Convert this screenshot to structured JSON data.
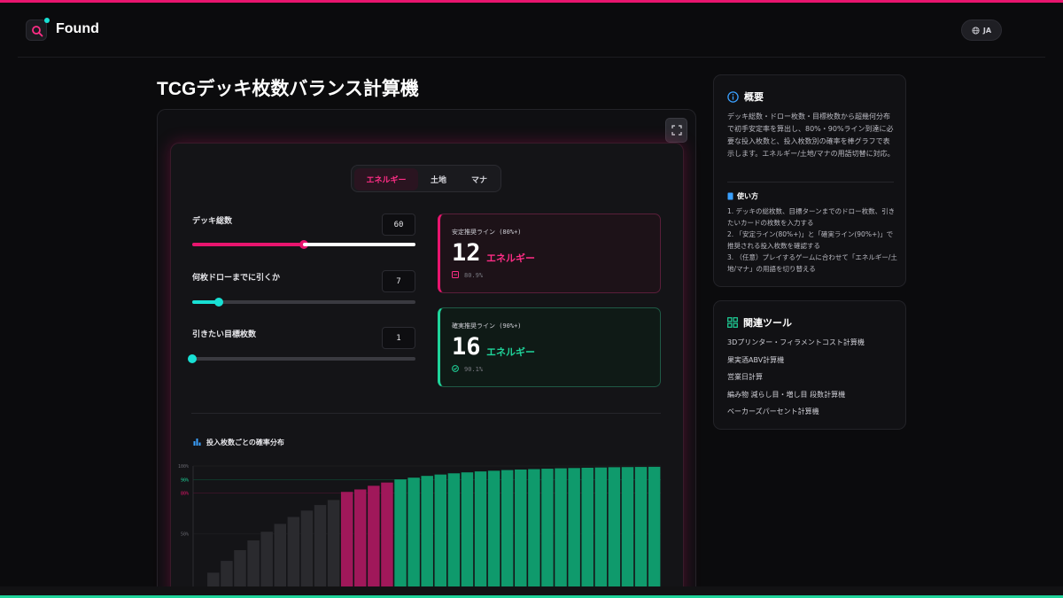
{
  "brand": "Found",
  "lang": "JA",
  "page_title": "TCGデッキ枚数バランス計算機",
  "tabs": [
    {
      "label": "エネルギー",
      "active": true
    },
    {
      "label": "土地",
      "active": false
    },
    {
      "label": "マナ",
      "active": false
    }
  ],
  "inputs": {
    "deck": {
      "label": "デッキ総数",
      "value": "60",
      "slider_fraction": 0.5
    },
    "draws": {
      "label": "何枚ドローまでに引くか",
      "value": "7",
      "slider_fraction": 0.12
    },
    "target": {
      "label": "引きたい目標枚数",
      "value": "1",
      "slider_fraction": 0.0
    }
  },
  "results": {
    "stable": {
      "title": "安定推奨ライン (80%+)",
      "count": "12",
      "unit": "エネルギー",
      "prob": "80.9%"
    },
    "sure": {
      "title": "確実推奨ライン (90%+)",
      "count": "16",
      "unit": "エネルギー",
      "prob": "90.1%"
    }
  },
  "chart_title": "投入枚数ごとの確率分布",
  "chart_data": {
    "type": "bar",
    "ylim": [
      0,
      100
    ],
    "y_tick_labels": [
      "100%",
      "90%",
      "80%",
      "50%"
    ],
    "y_ticks": [
      100,
      90,
      80,
      50
    ],
    "values": [
      11.1,
      21.3,
      30.0,
      37.9,
      45.1,
      51.5,
      57.3,
      62.4,
      67.1,
      71.2,
      74.9,
      80.9,
      82.7,
      85.4,
      87.8,
      90.1,
      91.4,
      92.7,
      93.7,
      94.6,
      95.3,
      96.0,
      96.5,
      97.0,
      97.4,
      97.7,
      98.0,
      98.3,
      98.5,
      98.7,
      98.9,
      99.1,
      99.2,
      99.3,
      99.4
    ],
    "colors": {
      "low": "#2a2a2e",
      "stable": "#a0185a",
      "sure": "#0f9a6c"
    }
  },
  "overview": {
    "heading": "概要",
    "body": "デッキ総数・ドロー枚数・目標枚数から超幾何分布で初手安定率を算出し、80%・90%ライン到達に必要な投入枚数と、投入枚数別の確率を棒グラフで表示します。エネルギー/土地/マナの用語切替に対応。",
    "usage_heading": "使い方",
    "usage": [
      "1. デッキの総枚数、目標ターンまでのドロー枚数、引きたいカードの枚数を入力する",
      "2. 「安定ライン(80%+)」と「確実ライン(90%+)」で推奨される投入枚数を確認する",
      "3. （任意）プレイするゲームに合わせて「エネルギー/土地/マナ」の用語を切り替える"
    ]
  },
  "related": {
    "heading": "関連ツール",
    "items": [
      "3Dプリンター・フィラメントコスト計算機",
      "果実酒ABV計算機",
      "営業日計算",
      "編み物 減らし目・増し目 段数計算機",
      "ベーカーズパーセント計算機"
    ]
  },
  "colors": {
    "accent_pink": "#e8156e",
    "accent_green": "#1fd49a",
    "accent_cyan": "#18e0d4"
  }
}
